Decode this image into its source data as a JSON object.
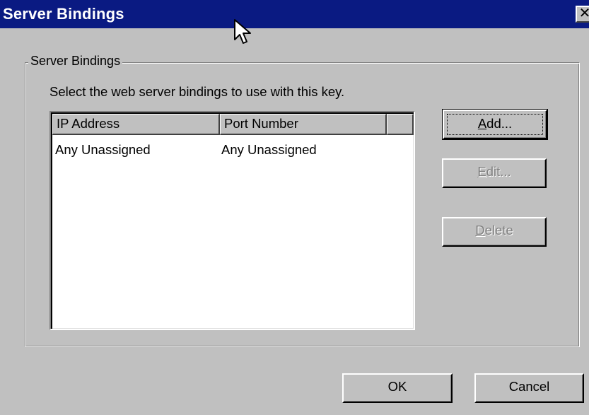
{
  "window": {
    "title": "Server Bindings",
    "close_glyph": "✕"
  },
  "group": {
    "label": "Server Bindings",
    "instruction": "Select the web server bindings to use with this key."
  },
  "bindings_list": {
    "columns": [
      "IP Address",
      "Port Number",
      ""
    ],
    "rows": [
      {
        "ip_address": "Any Unassigned",
        "port_number": "Any Unassigned"
      }
    ]
  },
  "side_buttons": {
    "add": {
      "mnemonic": "A",
      "rest": "dd...",
      "enabled": true
    },
    "edit": {
      "mnemonic": "E",
      "rest": "dit...",
      "enabled": false
    },
    "delete": {
      "mnemonic": "D",
      "rest": "elete",
      "enabled": false
    }
  },
  "footer_buttons": {
    "ok_label": "OK",
    "cancel_label": "Cancel"
  },
  "colors": {
    "titlebar": "#0a1a82",
    "face": "#c0c0c0",
    "list_background": "#ffffff",
    "disabled_text": "#808080"
  },
  "icons": {
    "close": "close-icon",
    "pointer": "mouse-pointer-icon"
  }
}
